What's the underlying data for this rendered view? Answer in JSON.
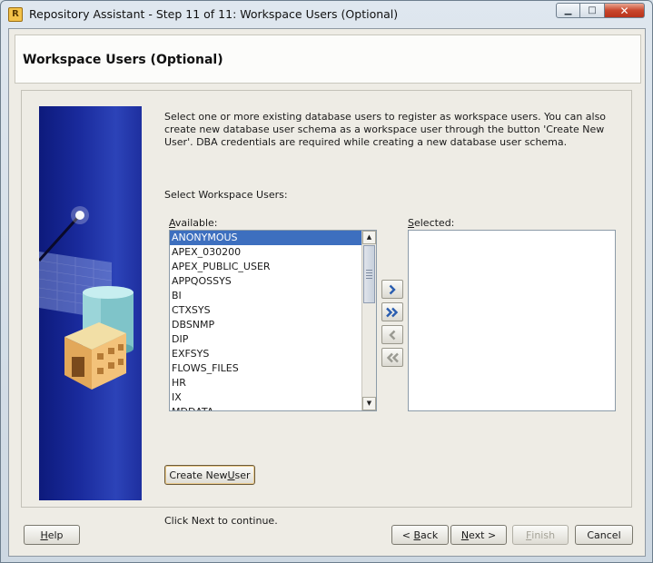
{
  "window": {
    "title": "Repository Assistant - Step 11 of 11: Workspace Users (Optional)",
    "app_icon_glyph": "R",
    "minimize_glyph": "▁",
    "maximize_glyph": "□",
    "close_glyph": "✕"
  },
  "page": {
    "title": "Workspace Users (Optional)",
    "intro": "Select one or more existing database users to register as workspace users. You can also create new database user schema as a workspace user through the button 'Create New User'. DBA credentials are required while creating a new database user schema.",
    "select_label": "Select Workspace Users:"
  },
  "available": {
    "label_mnemonic": "A",
    "label_rest": "vailable:",
    "items": [
      "ANONYMOUS",
      "APEX_030200",
      "APEX_PUBLIC_USER",
      "APPQOSSYS",
      "BI",
      "CTXSYS",
      "DBSNMP",
      "DIP",
      "EXFSYS",
      "FLOWS_FILES",
      "HR",
      "IX",
      "MDDATA"
    ],
    "selected_item": "ANONYMOUS"
  },
  "selected": {
    "label_mnemonic": "S",
    "label_rest": "elected:",
    "items": []
  },
  "shuttle": {
    "move_right_icon": "chevron-right-icon",
    "move_all_right_icon": "double-chevron-right-icon",
    "move_left_icon": "chevron-left-icon",
    "move_all_left_icon": "double-chevron-left-icon"
  },
  "create_user_button": {
    "pre": "Create New ",
    "mnemonic": "U",
    "post": "ser"
  },
  "footer": {
    "note": "Click Next to continue.",
    "help": {
      "pre": "",
      "mnemonic": "H",
      "post": "elp"
    },
    "back": {
      "pre": "< ",
      "mnemonic": "B",
      "post": "ack"
    },
    "next": {
      "pre": "",
      "mnemonic": "N",
      "post": "ext >"
    },
    "finish": {
      "pre": "",
      "mnemonic": "F",
      "post": "inish"
    },
    "cancel": "Cancel"
  },
  "colors": {
    "selection": "#3d6fbf",
    "side_image_dark": "#0d1a7c",
    "shuttle_arrow_active": "#2a5db0",
    "shuttle_arrow_disabled": "#9a9a92"
  }
}
